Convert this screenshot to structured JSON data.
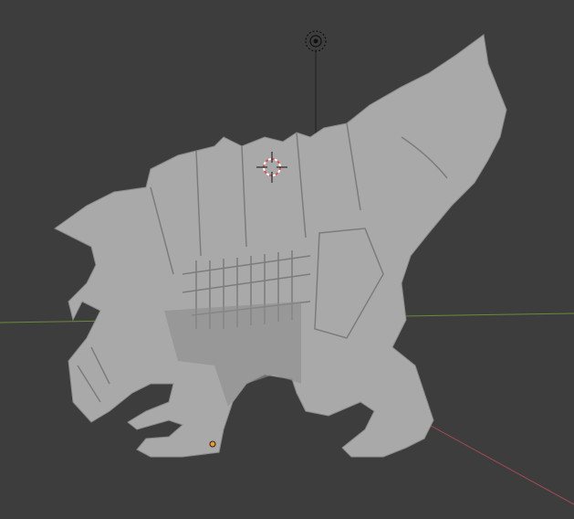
{
  "viewport": {
    "background": "#3d3d3d",
    "x_axis_color": "#6a8a3a",
    "y_axis_color": "#a04a55",
    "model_color": "#a9a9a9",
    "model_shadow": "#7c7c7c",
    "origin_color": "#f29a1e"
  },
  "icons": [
    "light-icon",
    "3d-cursor-icon",
    "object-origin-icon"
  ]
}
